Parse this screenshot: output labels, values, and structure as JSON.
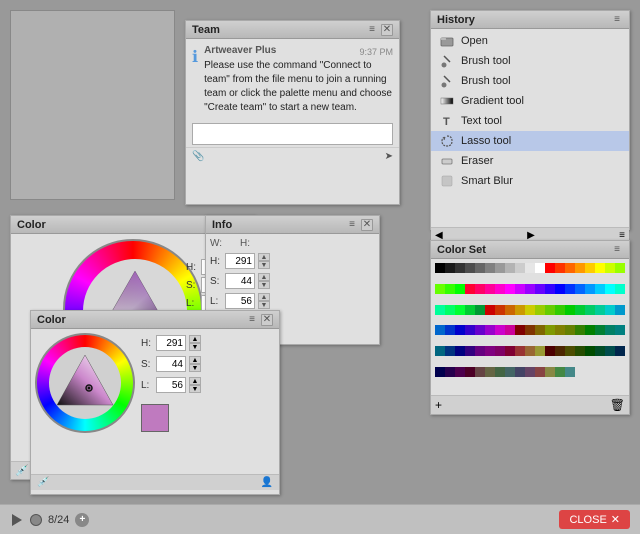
{
  "app": {
    "background_color": "#999999"
  },
  "bottom_bar": {
    "page_count": "8/24",
    "close_label": "CLOSE"
  },
  "team_panel": {
    "title": "Team",
    "sender": "Artweaver Plus",
    "time": "9:37 PM",
    "message": "Please use the command \"Connect to team\" from the file menu to join a running team or click the palette menu and choose \"Create team\" to start a new team."
  },
  "history_panel": {
    "title": "History",
    "items": [
      {
        "label": "Open",
        "icon": "folder"
      },
      {
        "label": "Brush tool",
        "icon": "brush"
      },
      {
        "label": "Brush tool",
        "icon": "brush"
      },
      {
        "label": "Gradient tool",
        "icon": "gradient"
      },
      {
        "label": "Text tool",
        "icon": "text"
      },
      {
        "label": "Lasso tool",
        "icon": "lasso",
        "selected": true
      },
      {
        "label": "Eraser",
        "icon": "eraser"
      },
      {
        "label": "Smart Blur",
        "icon": "blur"
      }
    ]
  },
  "color_panel": {
    "title": "Color",
    "hue": 291,
    "saturation": 44,
    "lightness": 56,
    "preview_color": "#bf7abf"
  },
  "color_small_panel": {
    "title": "Color",
    "hue": 291,
    "saturation": 44,
    "lightness": 56,
    "preview_color": "#bf7abf"
  },
  "info_panel": {
    "title": "Info"
  },
  "colorset_panel": {
    "title": "Color Set"
  },
  "swatches": [
    "#000000",
    "#1a1a1a",
    "#333333",
    "#4d4d4d",
    "#666666",
    "#808080",
    "#999999",
    "#b3b3b3",
    "#cccccc",
    "#e6e6e6",
    "#ffffff",
    "#ff0000",
    "#ff3300",
    "#ff6600",
    "#ff9900",
    "#ffcc00",
    "#ffff00",
    "#ccff00",
    "#99ff00",
    "#66ff00",
    "#33ff00",
    "#00ff00",
    "#ff0033",
    "#ff0066",
    "#ff0099",
    "#ff00cc",
    "#ff00ff",
    "#cc00ff",
    "#9900ff",
    "#6600ff",
    "#3300ff",
    "#0000ff",
    "#0033ff",
    "#0066ff",
    "#0099ff",
    "#00ccff",
    "#00ffff",
    "#00ffcc",
    "#00ff99",
    "#00ff66",
    "#00ff33",
    "#00cc33",
    "#009933",
    "#cc0000",
    "#cc3300",
    "#cc6600",
    "#cc9900",
    "#cccc00",
    "#99cc00",
    "#66cc00",
    "#33cc00",
    "#00cc00",
    "#00cc33",
    "#00cc66",
    "#00cc99",
    "#00cccc",
    "#0099cc",
    "#0066cc",
    "#0033cc",
    "#0000cc",
    "#3300cc",
    "#6600cc",
    "#9900cc",
    "#cc00cc",
    "#cc0099",
    "#800000",
    "#803300",
    "#806600",
    "#809900",
    "#808000",
    "#668000",
    "#338000",
    "#008000",
    "#008033",
    "#008066",
    "#008080",
    "#006680",
    "#003380",
    "#000080",
    "#330080",
    "#660080",
    "#800080",
    "#800066",
    "#800033",
    "#993333",
    "#996633",
    "#999933",
    "#4d0000",
    "#4d2600",
    "#4d4d00",
    "#264d00",
    "#004d00",
    "#004d26",
    "#004d4d",
    "#00264d",
    "#00004d",
    "#26004d",
    "#4d004d",
    "#4d0026",
    "#664444",
    "#666644",
    "#446644",
    "#446666",
    "#444466",
    "#664466",
    "#884444",
    "#888844",
    "#448844",
    "#448888"
  ]
}
